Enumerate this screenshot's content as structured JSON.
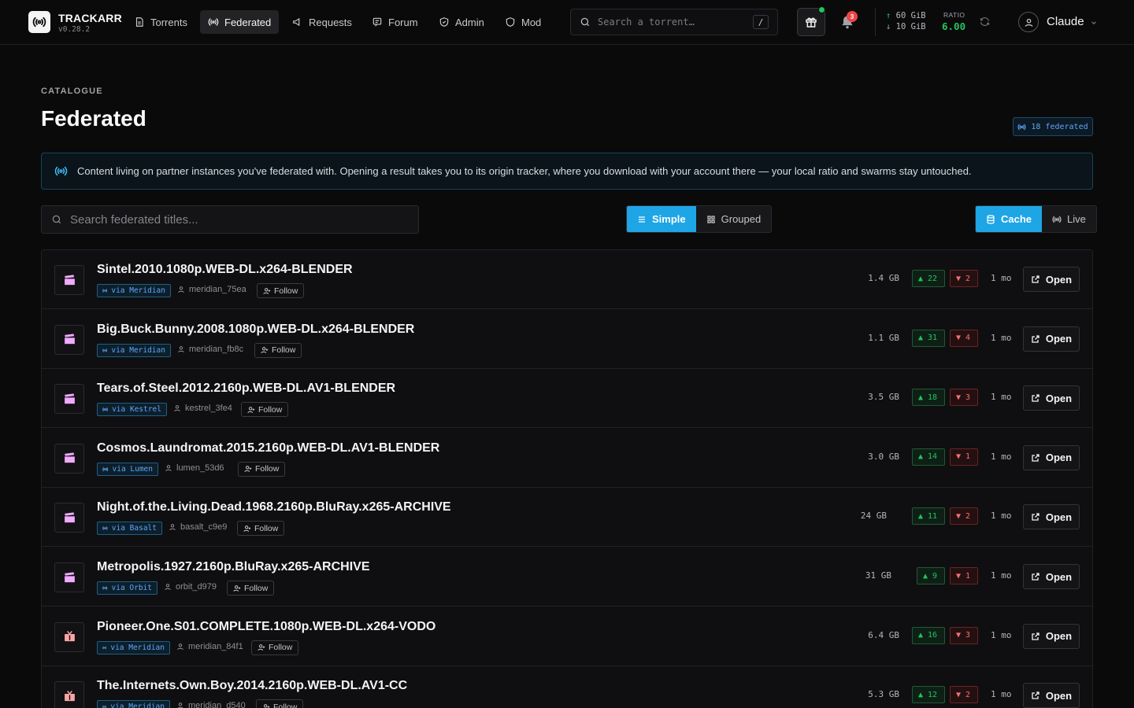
{
  "app": {
    "name": "TRACKARR",
    "version": "v0.28.2"
  },
  "nav": [
    {
      "label": "Torrents",
      "icon": "file-icon",
      "active": false
    },
    {
      "label": "Federated",
      "icon": "broadcast-icon",
      "active": true
    },
    {
      "label": "Requests",
      "icon": "megaphone-icon",
      "active": false
    },
    {
      "label": "Forum",
      "icon": "message-icon",
      "active": false
    },
    {
      "label": "Admin",
      "icon": "shield-check-icon",
      "active": false
    },
    {
      "label": "Mod",
      "icon": "shield-icon",
      "active": false
    }
  ],
  "search": {
    "placeholder": "Search a torrent…",
    "shortcut": "/"
  },
  "notifications": {
    "count": "3"
  },
  "stats": {
    "upload": "60 GiB",
    "download": "10 GiB",
    "ratio_label": "RATIO",
    "ratio": "6.00"
  },
  "user": {
    "name": "Claude"
  },
  "page": {
    "eyebrow": "CATALOGUE",
    "title": "Federated",
    "badge": "18 federated",
    "info": "Content living on partner instances you've federated with. Opening a result takes you to its origin tracker, where you download with your account there — your local ratio and swarms stay untouched."
  },
  "filter": {
    "placeholder": "Search federated titles...",
    "view_modes": [
      "Simple",
      "Grouped"
    ],
    "active_view": "Simple",
    "sources": [
      "Cache",
      "Live"
    ],
    "active_source": "Cache"
  },
  "labels": {
    "follow": "Follow",
    "open": "Open"
  },
  "colors": {
    "accent": "#1ea5e6",
    "seed": "#22c55e",
    "leech": "#f87171",
    "movie_icon": "#f0abfc",
    "tv_icon": "#fca5a5"
  },
  "torrents": [
    {
      "title": "Sintel.2010.1080p.WEB-DL.x264-BLENDER",
      "via": "via Meridian",
      "uploader": "meridian_75ea",
      "size": "1.4 GB",
      "seeders": "22",
      "leechers": "2",
      "age": "1 mo",
      "category": "movie"
    },
    {
      "title": "Big.Buck.Bunny.2008.1080p.WEB-DL.x264-BLENDER",
      "via": "via Meridian",
      "uploader": "meridian_fb8c",
      "size": "1.1 GB",
      "seeders": "31",
      "leechers": "4",
      "age": "1 mo",
      "category": "movie"
    },
    {
      "title": "Tears.of.Steel.2012.2160p.WEB-DL.AV1-BLENDER",
      "via": "via Kestrel",
      "uploader": "kestrel_3fe4",
      "size": "3.5 GB",
      "seeders": "18",
      "leechers": "3",
      "age": "1 mo",
      "category": "movie"
    },
    {
      "title": "Cosmos.Laundromat.2015.2160p.WEB-DL.AV1-BLENDER",
      "via": "via Lumen",
      "uploader": "lumen_53d6",
      "size": "3.0 GB",
      "seeders": "14",
      "leechers": "1",
      "age": "1 mo",
      "category": "movie"
    },
    {
      "title": "Night.of.the.Living.Dead.1968.2160p.BluRay.x265-ARCHIVE",
      "via": "via Basalt",
      "uploader": "basalt_c9e9",
      "size": "24 GB",
      "seeders": "11",
      "leechers": "2",
      "age": "1 mo",
      "category": "movie"
    },
    {
      "title": "Metropolis.1927.2160p.BluRay.x265-ARCHIVE",
      "via": "via Orbit",
      "uploader": "orbit_d979",
      "size": "31 GB",
      "seeders": "9",
      "leechers": "1",
      "age": "1 mo",
      "category": "movie"
    },
    {
      "title": "Pioneer.One.S01.COMPLETE.1080p.WEB-DL.x264-VODO",
      "via": "via Meridian",
      "uploader": "meridian_84f1",
      "size": "6.4 GB",
      "seeders": "16",
      "leechers": "3",
      "age": "1 mo",
      "category": "tv"
    },
    {
      "title": "The.Internets.Own.Boy.2014.2160p.WEB-DL.AV1-CC",
      "via": "via Meridian",
      "uploader": "meridian_d540",
      "size": "5.3 GB",
      "seeders": "12",
      "leechers": "2",
      "age": "1 mo",
      "category": "tv"
    }
  ]
}
